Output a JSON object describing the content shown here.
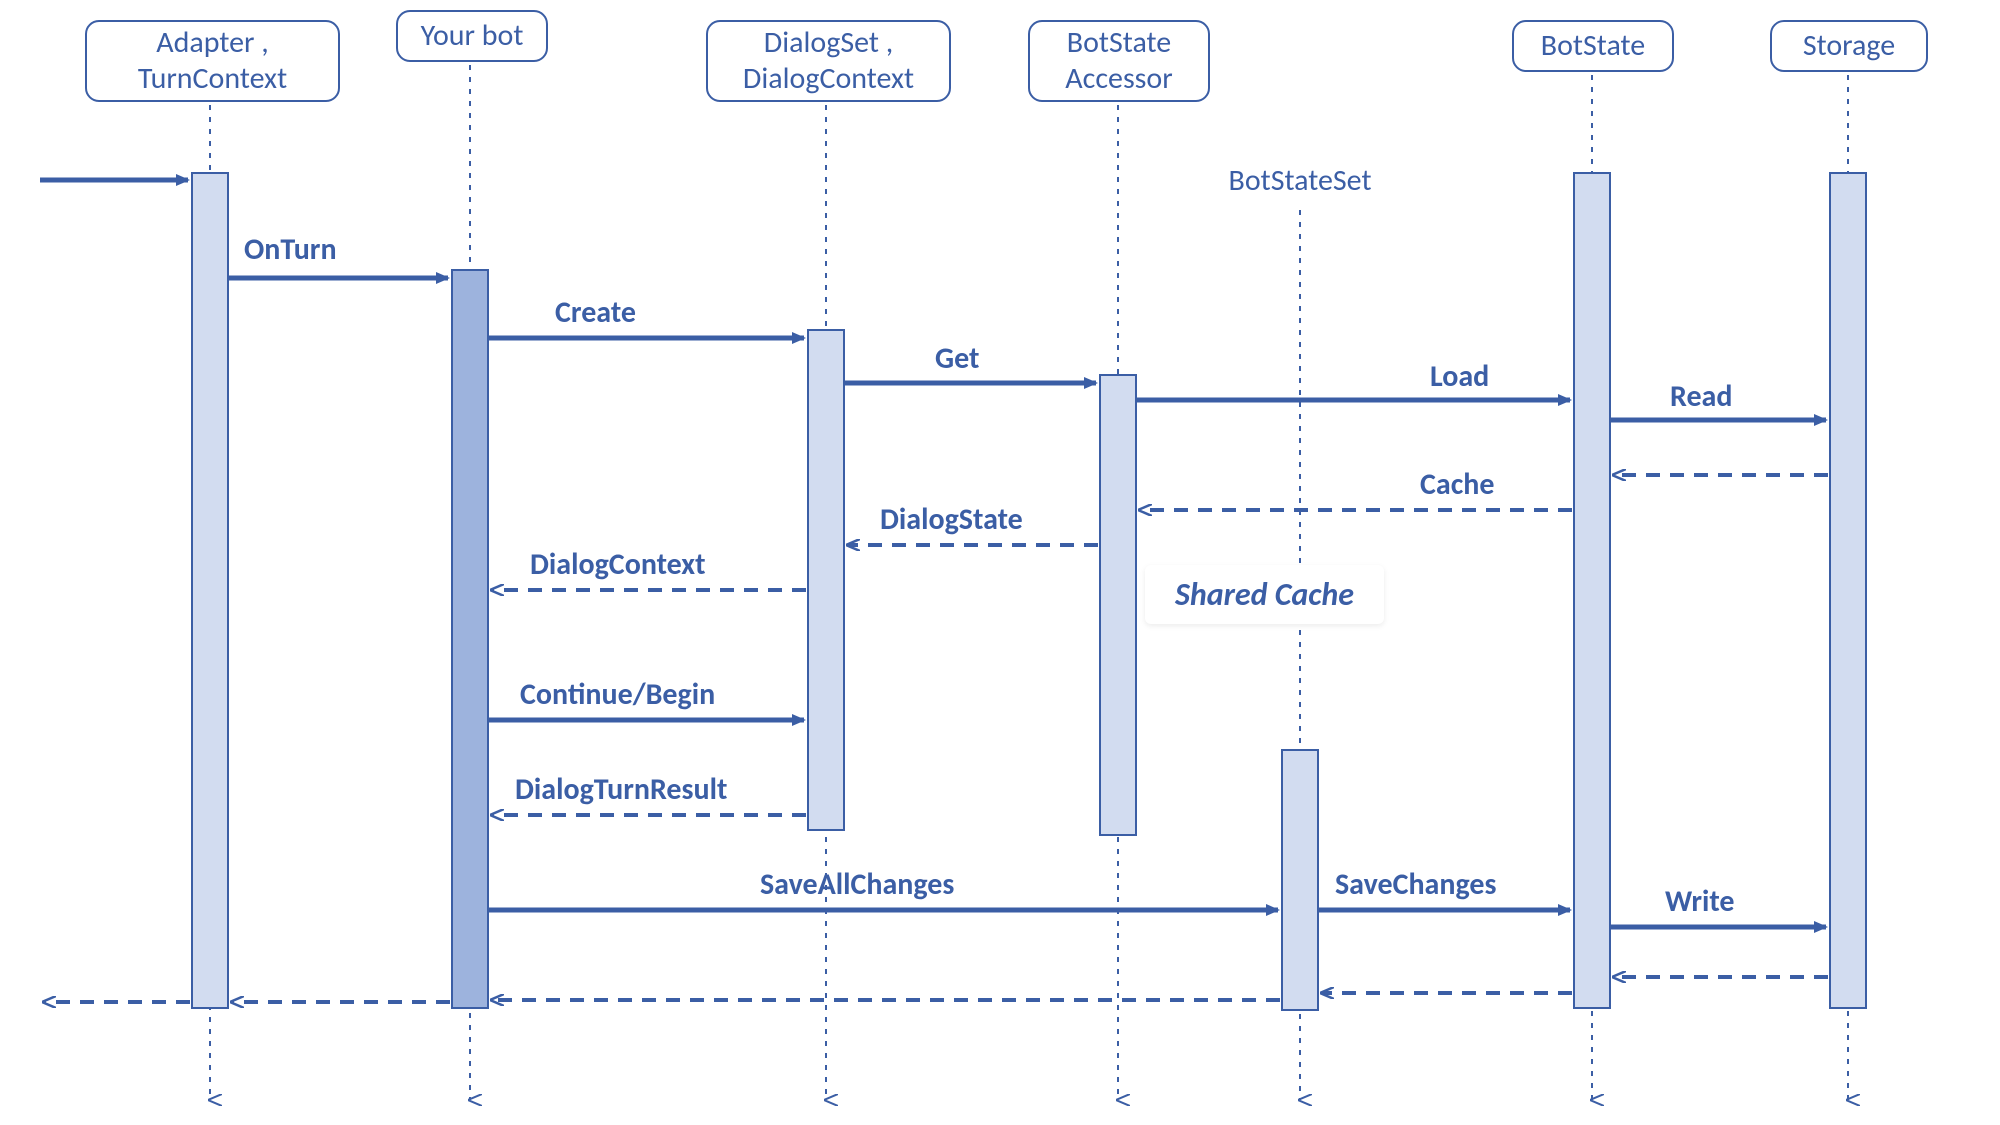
{
  "participants": {
    "adapter": "Adapter , TurnContext",
    "bot": "Your bot",
    "dialog": "DialogSet , DialogContext",
    "accessor": "BotState Accessor",
    "stateset": "BotStateSet",
    "botstate": "BotState",
    "storage": "Storage"
  },
  "messages": {
    "onturn": "OnTurn",
    "create": "Create",
    "get": "Get",
    "load": "Load",
    "read": "Read",
    "cache": "Cache",
    "dialogstate": "DialogState",
    "dialogcontext": "DialogContext",
    "continue": "Continue/Begin",
    "dialogturnresult": "DialogTurnResult",
    "saveall": "SaveAllChanges",
    "savechanges": "SaveChanges",
    "write": "Write"
  },
  "sharedCache": "Shared Cache",
  "colors": {
    "blue": "#3b5ea5",
    "fillLight": "#d2dcf0",
    "fillMed": "#9db3dd"
  }
}
